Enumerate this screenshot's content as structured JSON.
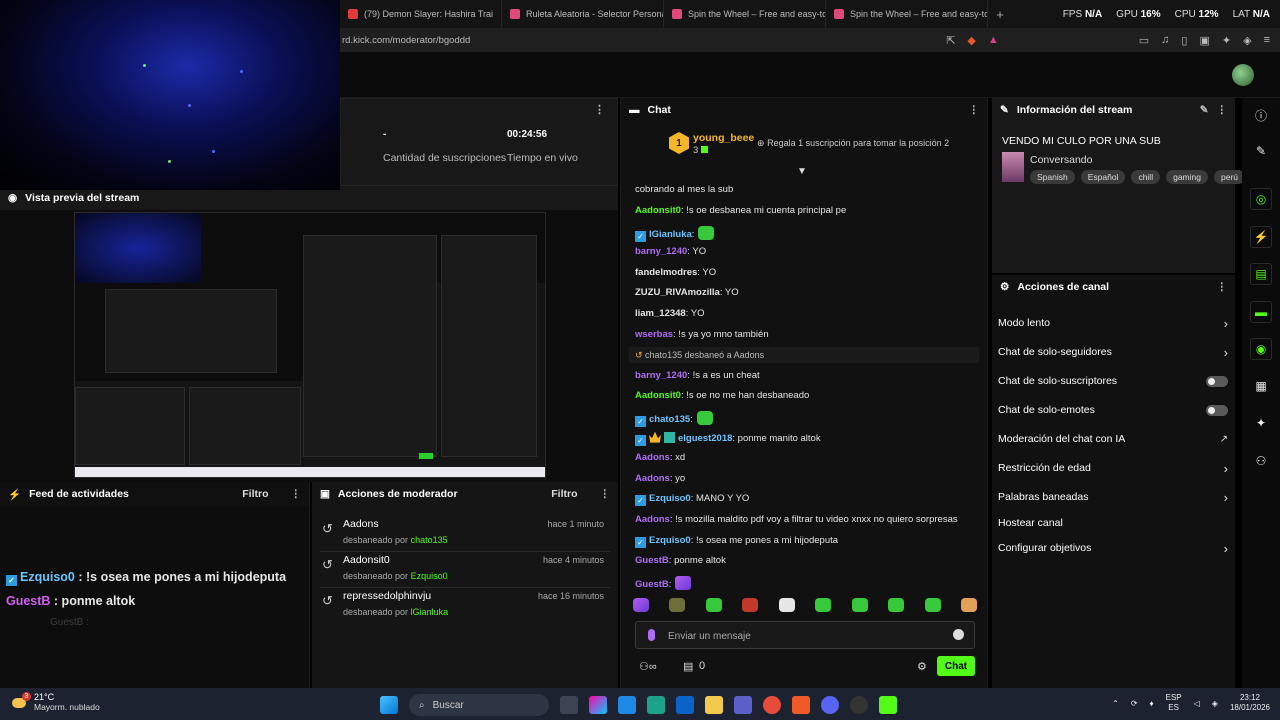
{
  "browser": {
    "tabs": [
      {
        "title": "(79) Demon Slayer: Hashira Trai",
        "color": "#e23b3b"
      },
      {
        "title": "Ruleta Aleatoria - Selector Personaliz",
        "color": "#e04a78"
      },
      {
        "title": "Spin the Wheel – Free and easy-to-us",
        "color": "#e04a78"
      },
      {
        "title": "Spin the Wheel – Free and easy-to-us",
        "color": "#e04a78"
      }
    ],
    "new_tab": "+",
    "stats": [
      {
        "label": "FPS",
        "value": "N/A"
      },
      {
        "label": "GPU",
        "value": "16%"
      },
      {
        "label": "CPU",
        "value": "12%"
      },
      {
        "label": "LAT",
        "value": "N/A"
      }
    ],
    "url": "rd.kick.com/moderator/bgoddd"
  },
  "stream_stats": {
    "subs_value": "-",
    "subs_label": "Cantidad de suscripciones",
    "live_value": "00:24:56",
    "live_label": "Tiempo en vivo"
  },
  "preview": {
    "title": "Vista previa del stream"
  },
  "feed": {
    "title": "Feed de actividades",
    "filter": "Filtro",
    "lines": [
      {
        "user": "Ezquiso0",
        "text": " : !s osea me pones a mi hijodeputa"
      },
      {
        "user": "GuestB",
        "text": " : ponme altok"
      }
    ],
    "ghost": "GuestB :"
  },
  "mod_actions": {
    "title": "Acciones de moderador",
    "filter": "Filtro",
    "rows": [
      {
        "name": "Aadons",
        "by_prefix": "desbaneado por ",
        "by": "chato135",
        "time": "hace 1 minuto"
      },
      {
        "name": "Aadonsit0",
        "by_prefix": "desbaneado por ",
        "by": "Ezquiso0",
        "time": "hace 4 minutos"
      },
      {
        "name": "repressedolphinvju",
        "by_prefix": "desbaneado por ",
        "by": "lGianluka",
        "time": "hace 16 minutos"
      }
    ]
  },
  "chat": {
    "title": "Chat",
    "pinned": {
      "rank": "1",
      "user": "young_beee",
      "count": "3",
      "gift_text": "Regala 1 suscripción para tomar la posición 2"
    },
    "top_fragment": "cobrando al mes la sub",
    "messages": [
      {
        "user": "Aadonsit0",
        "text": ": !s oe desbanea mi cuenta principal pe",
        "color": "green"
      },
      {
        "user": "lGianluka",
        "text": ":",
        "color": "blue",
        "badges": [
          "i"
        ],
        "emote": "green"
      },
      {
        "user": "barny_1240",
        "text": ": YO",
        "color": "purple"
      },
      {
        "user": "fandelmodres",
        "text": ": YO",
        "color": "white"
      },
      {
        "user": "ZUZU_RIVAmozilla",
        "text": ": YO",
        "color": "white"
      },
      {
        "user": "liam_12348",
        "text": ": YO",
        "color": "white"
      },
      {
        "user": "wserbas",
        "text": ": !s ya yo mno también",
        "color": "purple"
      },
      {
        "ban": "chato135 desbaneó a Aadons"
      },
      {
        "user": "barny_1240",
        "text": ": !s a es un cheat",
        "color": "purple"
      },
      {
        "user": "Aadonsit0",
        "text": ": !s oe no me han desbaneado",
        "color": "green"
      },
      {
        "user": "chato135",
        "text": ":",
        "color": "blue",
        "badges": [
          "i"
        ],
        "emote": "green"
      },
      {
        "user": "elguest2018",
        "text": ": ponme manito altok",
        "color": "blue",
        "badges": [
          "i",
          "c",
          "v"
        ]
      },
      {
        "user": "Aadons",
        "text": ": xd",
        "color": "purple"
      },
      {
        "user": "Aadons",
        "text": ": yo",
        "color": "purple"
      },
      {
        "user": "Ezquiso0",
        "text": ": MANO Y YO",
        "color": "blue",
        "badges": [
          "i"
        ]
      },
      {
        "user": "Aadons",
        "text": ": !s mozilla maldito pdf voy a filtrar tu video xnxx no quiero sorpresas",
        "color": "purple"
      },
      {
        "user": "Ezquiso0",
        "text": ": !s osea me pones a mi hijodeputa",
        "color": "blue",
        "badges": [
          "i"
        ]
      },
      {
        "user": "GuestB",
        "text": ": ponme altok",
        "color": "purple"
      },
      {
        "user": "GuestB",
        "text": ":",
        "color": "purple",
        "emote": "purple"
      }
    ],
    "input_placeholder": "Enviar un mensaje",
    "foot_count": "0",
    "send_label": "Chat"
  },
  "stream_info": {
    "title": "Información del stream",
    "stream_title": "VENDO MI CULO POR UNA SUB",
    "category": "Conversando",
    "tags": [
      "Spanish",
      "Español",
      "chill",
      "gaming",
      "perú"
    ]
  },
  "channel_actions": {
    "title": "Acciones de canal",
    "items": [
      {
        "label": "Modo lento",
        "control": "arrow"
      },
      {
        "label": "Chat de solo-seguidores",
        "control": "arrow"
      },
      {
        "label": "Chat de solo-suscriptores",
        "control": "toggle"
      },
      {
        "label": "Chat de solo-emotes",
        "control": "toggle"
      },
      {
        "label": "Moderación del chat con IA",
        "control": "external"
      },
      {
        "label": "Restricción de edad",
        "control": "arrow"
      },
      {
        "label": "Palabras baneadas",
        "control": "arrow"
      },
      {
        "label": "Hostear canal",
        "control": "none"
      },
      {
        "label": "Configurar objetivos",
        "control": "arrow"
      }
    ]
  },
  "taskbar": {
    "weather_badge": "3",
    "temp": "21°C",
    "weather": "Mayorm. nublado",
    "search": "Buscar",
    "lang_top": "ESP",
    "lang_bottom": "ES",
    "time": "23:12",
    "date": "18/01/2026"
  }
}
